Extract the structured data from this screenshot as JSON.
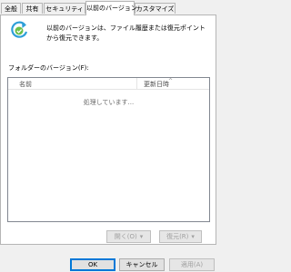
{
  "tabs": [
    {
      "label": "全般"
    },
    {
      "label": "共有"
    },
    {
      "label": "セキュリティ"
    },
    {
      "label": "以前のバージョン"
    },
    {
      "label": "カスタマイズ"
    }
  ],
  "description": "以前のバージョンは、ファイル履歴または復元ポイントから復元できます。",
  "folder_versions_label": "フォルダーのバージョン(F):",
  "list": {
    "columns": {
      "name": "名前",
      "date_modified": "更新日時"
    },
    "status": "処理しています..."
  },
  "buttons": {
    "open": "開く(O)",
    "restore": "復元(R)",
    "ok": "OK",
    "cancel": "キャンセル",
    "apply": "適用(A)"
  }
}
